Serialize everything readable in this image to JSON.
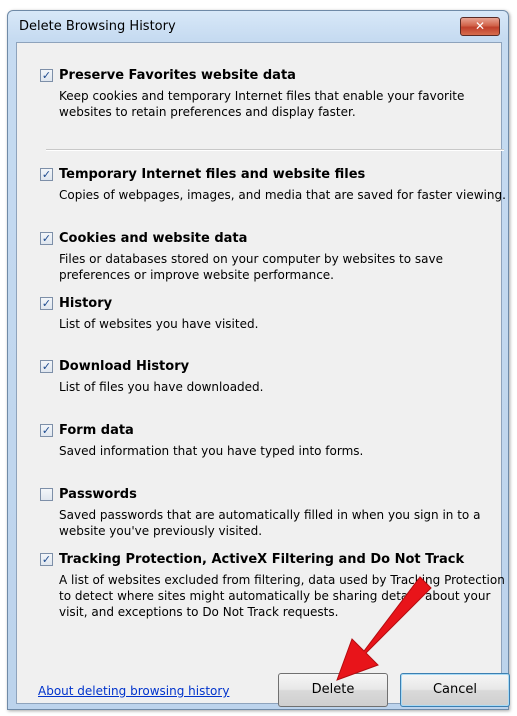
{
  "window": {
    "title": "Delete Browsing History",
    "close_glyph": "✕"
  },
  "items": [
    {
      "label": "Preserve Favorites website data",
      "checked": true,
      "description": "Keep cookies and temporary Internet files that enable your favorite websites to retain preferences and display faster."
    },
    {
      "label": "Temporary Internet files and website files",
      "checked": true,
      "description": "Copies of webpages, images, and media that are saved for faster viewing."
    },
    {
      "label": "Cookies and website data",
      "checked": true,
      "description": "Files or databases stored on your computer by websites to save preferences or improve website performance."
    },
    {
      "label": "History",
      "checked": true,
      "description": "List of websites you have visited."
    },
    {
      "label": "Download History",
      "checked": true,
      "description": "List of files you have downloaded."
    },
    {
      "label": "Form data",
      "checked": true,
      "description": "Saved information that you have typed into forms."
    },
    {
      "label": "Passwords",
      "checked": false,
      "description": "Saved passwords that are automatically filled in when you sign in to a website you've previously visited."
    },
    {
      "label": "Tracking Protection, ActiveX Filtering and Do Not Track",
      "checked": true,
      "description": "A list of websites excluded from filtering, data used by Tracking Protection to detect where sites might automatically be sharing details about your visit, and exceptions to Do Not Track requests."
    }
  ],
  "footer": {
    "link_text": "About deleting browsing history",
    "delete_label": "Delete",
    "cancel_label": "Cancel"
  },
  "colors": {
    "link": "#0033cc",
    "arrow": "#e8141a"
  }
}
